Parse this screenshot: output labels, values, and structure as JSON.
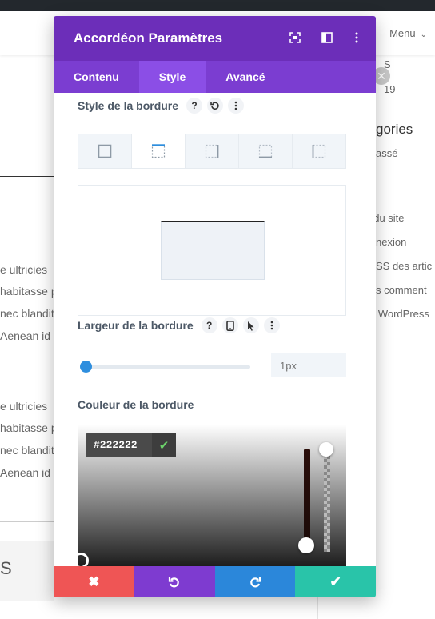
{
  "page": {
    "menu_label": "Menu",
    "left_fragments": [
      "e ultricies",
      "habitasse p",
      "nec blandit",
      "Aenean id",
      "e ultricies",
      "habitasse p",
      "nec blandit",
      "Aenean id"
    ],
    "right_fragments": [
      "S",
      "19",
      "gories",
      "assé",
      ". du site",
      "nexion",
      "SS des artic",
      "s comment",
      "e WordPress"
    ],
    "footer_fragment": "S"
  },
  "modal": {
    "title": "Accordéon Paramètres",
    "tabs": [
      {
        "label": "Contenu",
        "active": false
      },
      {
        "label": "Style",
        "active": true
      },
      {
        "label": "Avancé",
        "active": false
      }
    ],
    "border_style": {
      "label": "Style de la bordure",
      "help": "?",
      "options": [
        "all",
        "top",
        "right",
        "bottom",
        "left"
      ],
      "selected": "top"
    },
    "border_width": {
      "label": "Largeur de la bordure",
      "help": "?",
      "value_placeholder": "1px",
      "slider_fraction": 0.0
    },
    "border_color": {
      "label": "Couleur de la bordure",
      "hex": "#222222",
      "swatches": [
        "#000000",
        "#ffffff",
        "#e02b20",
        "#e09900",
        "#edf000",
        "#7cda24",
        "#0c71c3",
        "#8300e9"
      ]
    },
    "footer": {
      "cancel_color": "#ef5555",
      "undo_color": "#7e3bd0",
      "redo_color": "#2b87da",
      "save_color": "#29c4a9"
    },
    "colors": {
      "header": "#6c2eb9",
      "tabs": "#7b3dd1",
      "accent": "#2e8ede"
    }
  }
}
